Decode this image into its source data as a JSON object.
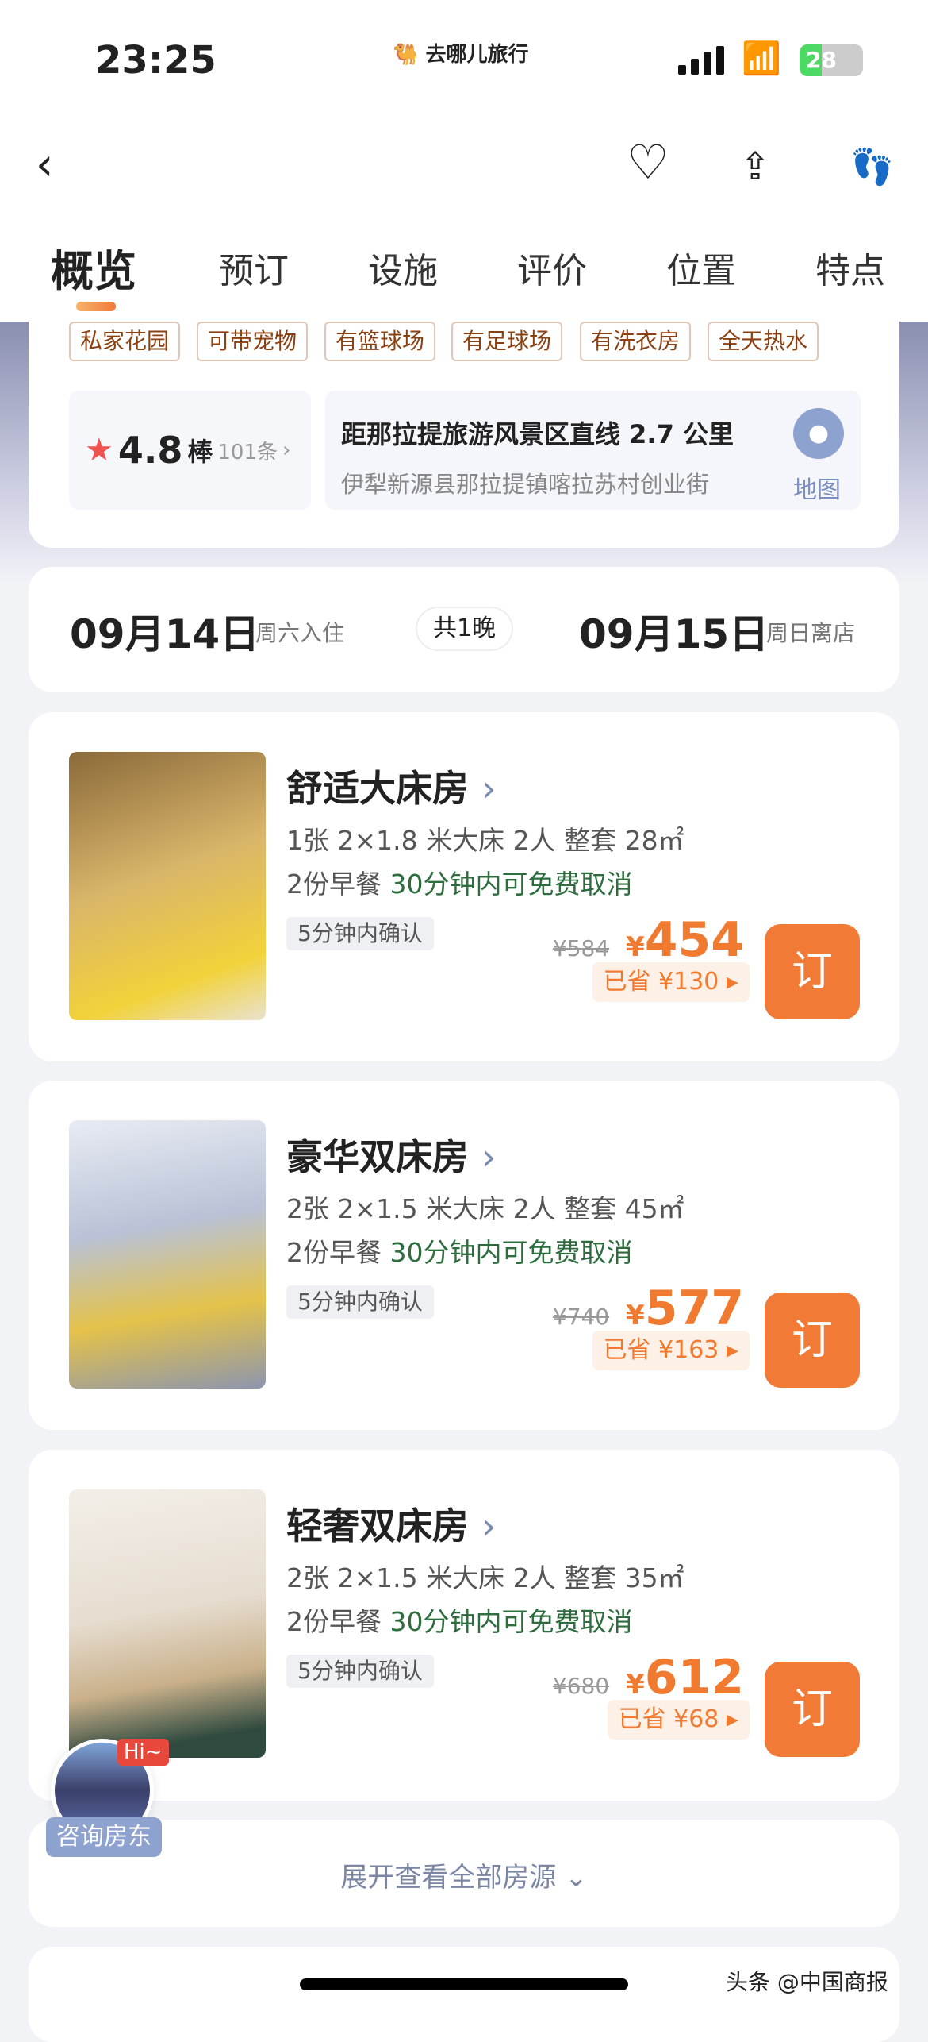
{
  "status": {
    "time": "23:25",
    "app_brand": "去哪儿旅行",
    "battery": "28"
  },
  "nav": {
    "back_icon": "chevron-left-icon",
    "favorite_icon": "heart-icon",
    "share_icon": "share-icon",
    "footprint_icon": "footprint-icon"
  },
  "tabs": [
    {
      "label": "概览",
      "active": true
    },
    {
      "label": "预订"
    },
    {
      "label": "设施"
    },
    {
      "label": "评价"
    },
    {
      "label": "位置"
    },
    {
      "label": "特点"
    }
  ],
  "tags": [
    "私家花园",
    "可带宠物",
    "有篮球场",
    "有足球场",
    "有洗衣房",
    "全天热水"
  ],
  "rating": {
    "score": "4.8",
    "word": "棒",
    "count": "101条"
  },
  "location": {
    "distance": "距那拉提旅游风景区直线 2.7 公里",
    "address": "伊犁新源县那拉提镇喀拉苏村创业街",
    "map_label": "地图"
  },
  "dates": {
    "checkin": "09月14日",
    "checkin_note": "周六入住",
    "nights": "共1晚",
    "checkout": "09月15日",
    "checkout_note": "周日离店"
  },
  "rooms": [
    {
      "title": "舒适大床房",
      "spec": "1张 2×1.8 米大床 2人 整套 28㎡",
      "breakfast": "2份早餐",
      "cancel": "30分钟内可免费取消",
      "confirm": "5分钟内确认",
      "original_price": "¥584",
      "currency": "¥",
      "price": "454",
      "saved": "已省 ¥130",
      "book": "订"
    },
    {
      "title": "豪华双床房",
      "spec": "2张 2×1.5 米大床 2人 整套 45㎡",
      "breakfast": "2份早餐",
      "cancel": "30分钟内可免费取消",
      "confirm": "5分钟内确认",
      "original_price": "¥740",
      "currency": "¥",
      "price": "577",
      "saved": "已省 ¥163",
      "book": "订"
    },
    {
      "title": "轻奢双床房",
      "spec": "2张 2×1.5 米大床 2人 整套 35㎡",
      "breakfast": "2份早餐",
      "cancel": "30分钟内可免费取消",
      "confirm": "5分钟内确认",
      "original_price": "¥680",
      "currency": "¥",
      "price": "612",
      "saved": "已省 ¥68",
      "book": "订"
    }
  ],
  "host": {
    "badge": "Hi~",
    "label": "咨询房东"
  },
  "expand": {
    "label": "展开查看全部房源"
  },
  "watermark": "头条 @中国商报",
  "colors": {
    "accent": "#f07a36",
    "green": "#2e6d3e",
    "tag_text": "#8a4010"
  }
}
